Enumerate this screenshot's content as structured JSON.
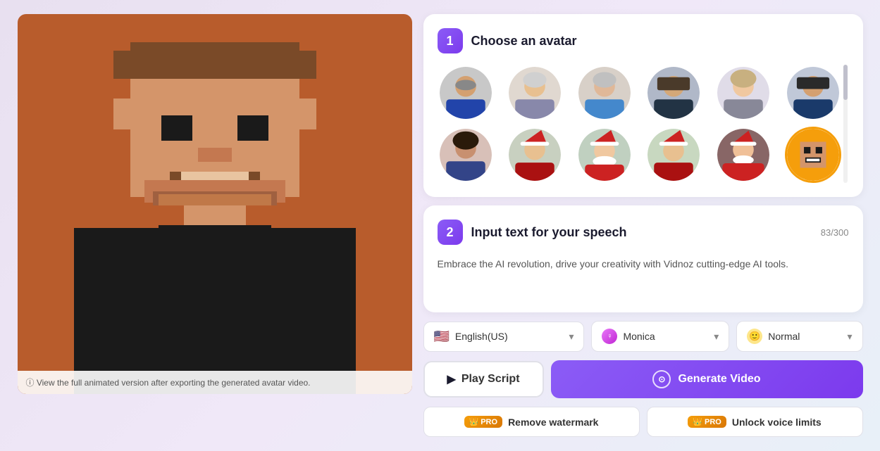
{
  "app": {
    "footer_note": "ⓘ View the full animated version after exporting the generated avatar video."
  },
  "step1": {
    "badge": "1",
    "title": "Choose an avatar",
    "avatars": [
      {
        "id": "av1",
        "label": "Older man with glasses",
        "selected": false,
        "class": "av1"
      },
      {
        "id": "av2",
        "label": "Older woman gray hair",
        "selected": false,
        "class": "av2"
      },
      {
        "id": "av3",
        "label": "Older woman blue top",
        "selected": false,
        "class": "av3"
      },
      {
        "id": "av4",
        "label": "Young man suit",
        "selected": false,
        "class": "av4"
      },
      {
        "id": "av5",
        "label": "Young woman",
        "selected": false,
        "class": "av5"
      },
      {
        "id": "av6",
        "label": "Young man casual",
        "selected": false,
        "class": "av6"
      },
      {
        "id": "av7",
        "label": "Woman dark hair",
        "selected": false,
        "class": "av7"
      },
      {
        "id": "av8",
        "label": "Older woman santa hat",
        "selected": false,
        "class": "av8"
      },
      {
        "id": "av9",
        "label": "Santa Claus",
        "selected": false,
        "class": "av9"
      },
      {
        "id": "av10",
        "label": "Woman santa hat",
        "selected": false,
        "class": "av10"
      },
      {
        "id": "av11",
        "label": "Santa outdoors",
        "selected": false,
        "class": "av11"
      },
      {
        "id": "av12",
        "label": "Pixel character",
        "selected": true,
        "class": "av12"
      }
    ]
  },
  "step2": {
    "badge": "2",
    "title": "Input text for your speech",
    "char_count": "83/300",
    "speech_text": "Embrace the AI revolution, drive your creativity with Vidnoz cutting-edge AI tools."
  },
  "controls": {
    "language": {
      "flag": "🇺🇸",
      "value": "English(US)",
      "chevron": "▾"
    },
    "voice": {
      "icon": "♀",
      "value": "Monica",
      "chevron": "▾"
    },
    "mood": {
      "icon": "🙂",
      "value": "Normal",
      "chevron": "▾"
    }
  },
  "buttons": {
    "play_script": "Play Script",
    "generate_video": "Generate Video",
    "remove_watermark": "Remove watermark",
    "unlock_voice": "Unlock voice limits",
    "pro_label": "PRO"
  }
}
